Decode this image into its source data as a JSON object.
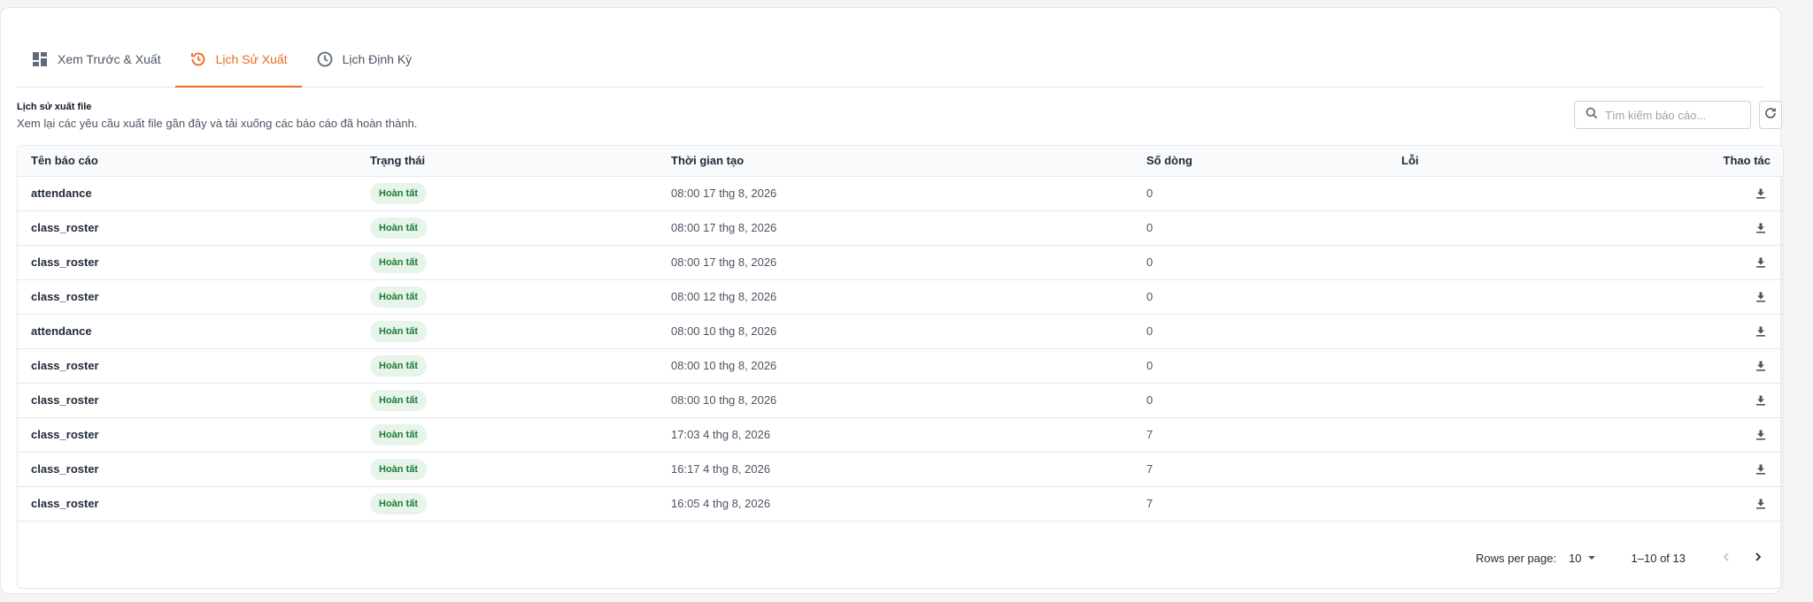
{
  "tabs": [
    {
      "label": "Xem Trước & Xuất",
      "icon": "dashboard-icon",
      "active": false
    },
    {
      "label": "Lịch Sử Xuất",
      "icon": "history-icon",
      "active": true
    },
    {
      "label": "Lịch Định Kỳ",
      "icon": "clock-icon",
      "active": false
    }
  ],
  "section": {
    "title": "Lịch sử xuất file",
    "description": "Xem lại các yêu cầu xuất file gần đây và tải xuống các báo cáo đã hoàn thành."
  },
  "search": {
    "placeholder": "Tìm kiếm báo cáo...",
    "value": ""
  },
  "colors": {
    "accent": "#ea6a1d",
    "badge_bg": "#e6f4ea",
    "badge_text": "#1e7b34"
  },
  "table": {
    "columns": [
      "Tên báo cáo",
      "Trạng thái",
      "Thời gian tạo",
      "Số dòng",
      "Lỗi",
      "Thao tác"
    ],
    "rows": [
      {
        "name": "attendance",
        "status": "Hoàn tất",
        "created": "08:00 17 thg 8, 2026",
        "rows": "0",
        "error": ""
      },
      {
        "name": "class_roster",
        "status": "Hoàn tất",
        "created": "08:00 17 thg 8, 2026",
        "rows": "0",
        "error": ""
      },
      {
        "name": "class_roster",
        "status": "Hoàn tất",
        "created": "08:00 17 thg 8, 2026",
        "rows": "0",
        "error": ""
      },
      {
        "name": "class_roster",
        "status": "Hoàn tất",
        "created": "08:00 12 thg 8, 2026",
        "rows": "0",
        "error": ""
      },
      {
        "name": "attendance",
        "status": "Hoàn tất",
        "created": "08:00 10 thg 8, 2026",
        "rows": "0",
        "error": ""
      },
      {
        "name": "class_roster",
        "status": "Hoàn tất",
        "created": "08:00 10 thg 8, 2026",
        "rows": "0",
        "error": ""
      },
      {
        "name": "class_roster",
        "status": "Hoàn tất",
        "created": "08:00 10 thg 8, 2026",
        "rows": "0",
        "error": ""
      },
      {
        "name": "class_roster",
        "status": "Hoàn tất",
        "created": "17:03 4 thg 8, 2026",
        "rows": "7",
        "error": ""
      },
      {
        "name": "class_roster",
        "status": "Hoàn tất",
        "created": "16:17 4 thg 8, 2026",
        "rows": "7",
        "error": ""
      },
      {
        "name": "class_roster",
        "status": "Hoàn tất",
        "created": "16:05 4 thg 8, 2026",
        "rows": "7",
        "error": ""
      }
    ]
  },
  "pagination": {
    "rows_per_page_label": "Rows per page:",
    "rows_per_page": "10",
    "range": "1–10 of 13"
  }
}
